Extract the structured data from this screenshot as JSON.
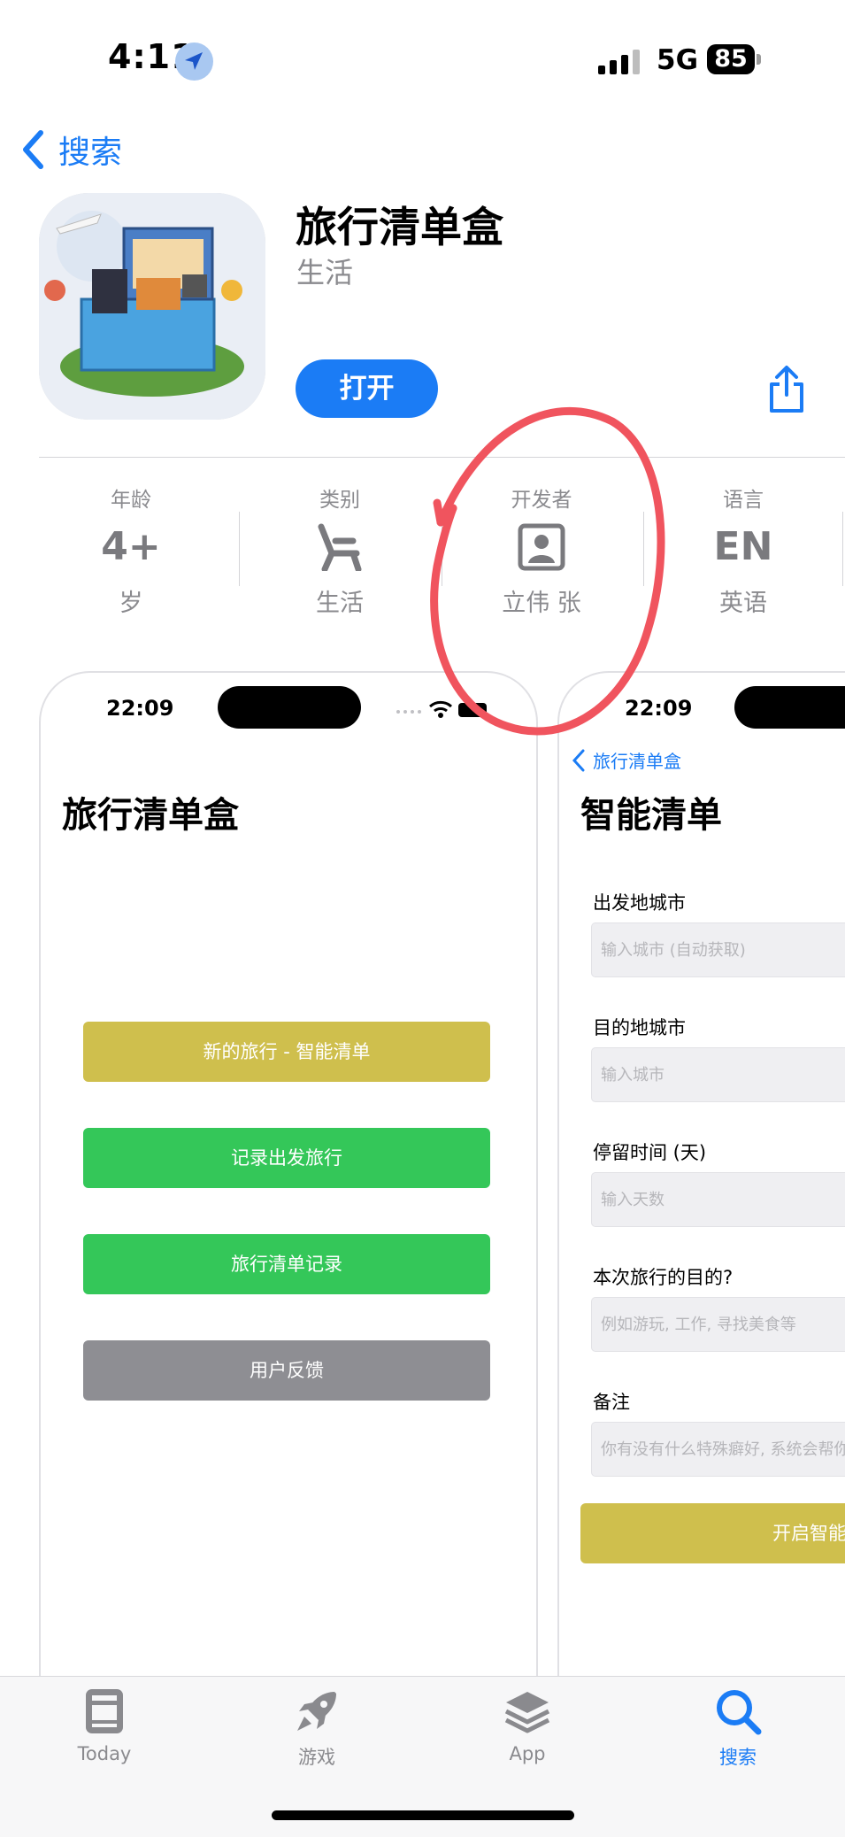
{
  "status_bar": {
    "time": "4:11",
    "network": "5G",
    "battery": "85"
  },
  "nav": {
    "back_label": "搜索"
  },
  "app": {
    "name": "旅行清单盒",
    "category": "生活",
    "open_label": "打开"
  },
  "info": [
    {
      "label": "年龄",
      "value": "4+",
      "sub": "岁"
    },
    {
      "label": "类别",
      "value": "",
      "sub": "生活",
      "icon": "chair-icon"
    },
    {
      "label": "开发者",
      "value": "",
      "sub": "立伟 张",
      "icon": "developer-person-icon"
    },
    {
      "label": "语言",
      "value": "EN",
      "sub": "英语"
    }
  ],
  "screenshot1": {
    "time": "22:09",
    "title": "旅行清单盒",
    "buttons": [
      {
        "label": "新的旅行 - 智能清单",
        "color": "#cfbf4d"
      },
      {
        "label": "记录出发旅行",
        "color": "#34c759"
      },
      {
        "label": "旅行清单记录",
        "color": "#34c759"
      },
      {
        "label": "用户反馈",
        "color": "#8e8e93"
      }
    ]
  },
  "screenshot2": {
    "time": "22:09",
    "back_label": "旅行清单盒",
    "title": "智能清单",
    "fields": [
      {
        "label": "出发地城市",
        "placeholder": "输入城市 (自动获取)"
      },
      {
        "label": "目的地城市",
        "placeholder": "输入城市"
      },
      {
        "label": "停留时间 (天)",
        "placeholder": "输入天数"
      },
      {
        "label": "本次旅行的目的?",
        "placeholder": "例如游玩, 工作, 寻找美食等"
      },
      {
        "label": "备注",
        "placeholder": "你有没有什么特殊癖好, 系统会帮你"
      }
    ],
    "submit_label": "开启智能清"
  },
  "tabbar": [
    {
      "label": "Today",
      "icon": "today-icon",
      "active": false
    },
    {
      "label": "游戏",
      "icon": "rocket-icon",
      "active": false
    },
    {
      "label": "App",
      "icon": "app-stack-icon",
      "active": false
    },
    {
      "label": "搜索",
      "icon": "search-icon",
      "active": true
    }
  ],
  "colors": {
    "accent": "#1b7cf5",
    "annotation": "#f0545e",
    "gray": "#8a8a8e"
  }
}
